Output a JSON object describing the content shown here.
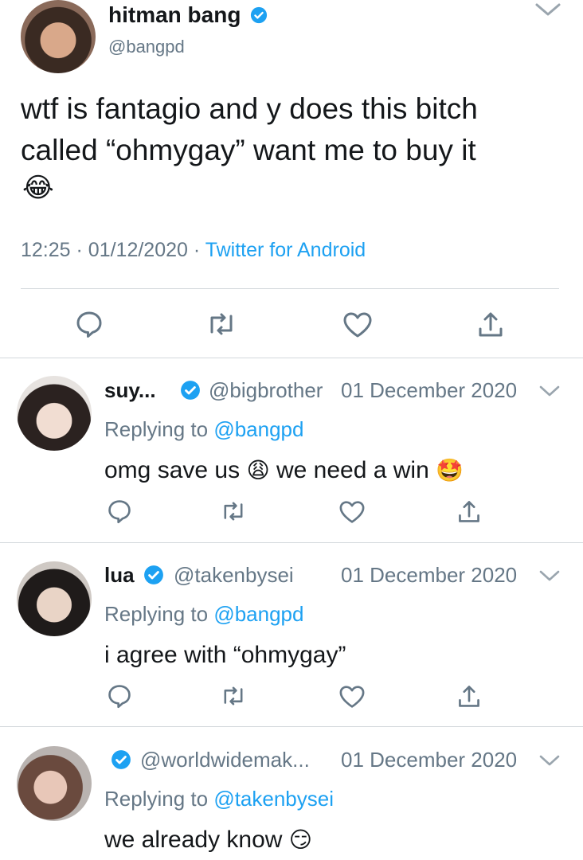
{
  "main_tweet": {
    "display_name": "hitman bang",
    "handle": "@bangpd",
    "text_line1": "wtf is fantagio and y does this bitch",
    "text_line2": "called “ohmygay” want me to buy it",
    "emoji": "😂",
    "time": "12:25",
    "date": "01/12/2020",
    "source": "Twitter for Android",
    "sep": "·"
  },
  "replies": [
    {
      "display_name": "suy...",
      "handle": "@bigbrother",
      "date": "01 December 2020",
      "replying_label": "Replying to",
      "replying_to": "@bangpd",
      "text_a": "omg save us",
      "emoji_a": "😩",
      "text_b": "we need a win",
      "emoji_b": "🤩"
    },
    {
      "display_name": "lua",
      "handle": "@takenbysei",
      "date": "01 December 2020",
      "replying_label": "Replying to",
      "replying_to": "@bangpd",
      "text": "i agree with “ohmygay”"
    },
    {
      "display_name": "",
      "handle": "@worldwidemak...",
      "date": "01 December 2020",
      "replying_label": "Replying to",
      "replying_to": "@takenbysei",
      "text": "we already know",
      "emoji": "😏"
    }
  ],
  "icons": [
    "chevron-down-icon",
    "verified-badge-icon",
    "reply-icon",
    "retweet-icon",
    "like-icon",
    "share-icon"
  ],
  "colors": {
    "blue": "#1da1f2",
    "grey": "#657786",
    "text": "#14171a",
    "divider": "#d3d8dc"
  }
}
